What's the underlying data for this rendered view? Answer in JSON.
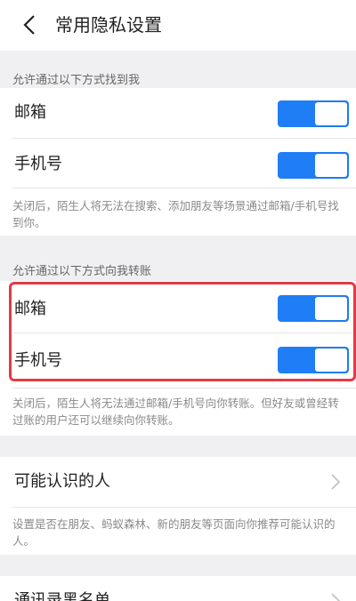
{
  "header": {
    "title": "常用隐私设置",
    "back_icon": "chevron-left-icon"
  },
  "section1": {
    "heading": "允许通过以下方式找到我",
    "items": [
      {
        "label": "邮箱",
        "enabled": true
      },
      {
        "label": "手机号",
        "enabled": true
      }
    ],
    "note": "关闭后，陌生人将无法在搜索、添加朋友等场景通过邮箱/手机号找到你。"
  },
  "section2": {
    "heading": "允许通过以下方式向我转账",
    "items": [
      {
        "label": "邮箱",
        "enabled": true
      },
      {
        "label": "手机号",
        "enabled": true
      }
    ],
    "note": "关闭后，陌生人将无法通过邮箱/手机号向你转账。但好友或曾经转过账的用户还可以继续向你转账。"
  },
  "section3": {
    "item": {
      "label": "可能认识的人"
    },
    "note": "设置是否在朋友、蚂蚁森林、新的朋友等页面向你推荐可能认识的人。"
  },
  "section4": {
    "item": {
      "label": "通讯录黑名单"
    }
  },
  "colors": {
    "toggle_on": "#1f7ef6",
    "highlight": "#e53a44",
    "background": "#f0f0f2"
  }
}
